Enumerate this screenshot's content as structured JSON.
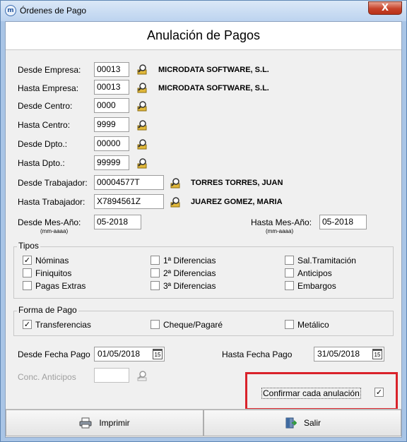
{
  "window": {
    "title": "Órdenes de Pago",
    "close": "X"
  },
  "header": {
    "title": "Anulación de Pagos"
  },
  "fields": {
    "desde_empresa": {
      "label": "Desde Empresa:",
      "value": "00013",
      "name": "MICRODATA SOFTWARE, S.L."
    },
    "hasta_empresa": {
      "label": "Hasta Empresa:",
      "value": "00013",
      "name": "MICRODATA SOFTWARE, S.L."
    },
    "desde_centro": {
      "label": "Desde Centro:",
      "value": "0000"
    },
    "hasta_centro": {
      "label": "Hasta Centro:",
      "value": "9999"
    },
    "desde_dpto": {
      "label": "Desde Dpto.:",
      "value": "00000"
    },
    "hasta_dpto": {
      "label": "Hasta Dpto.:",
      "value": "99999"
    },
    "desde_trabajador": {
      "label": "Desde Trabajador:",
      "value": "00004577T",
      "name": "TORRES TORRES, JUAN"
    },
    "hasta_trabajador": {
      "label": "Hasta Trabajador:",
      "value": "X7894561Z",
      "name": "JUAREZ GOMEZ, MARIA"
    },
    "desde_mes": {
      "label": "Desde Mes-Año:",
      "hint": "(mm-aaaa)",
      "value": "05-2018"
    },
    "hasta_mes": {
      "label": "Hasta Mes-Año:",
      "hint": "(mm-aaaa)",
      "value": "05-2018"
    }
  },
  "tipos": {
    "legend": "Tipos",
    "items": [
      {
        "label": "Nóminas",
        "checked": true
      },
      {
        "label": "Finiquitos",
        "checked": false
      },
      {
        "label": "Pagas Extras",
        "checked": false
      },
      {
        "label": "1ª Diferencias",
        "checked": false
      },
      {
        "label": "2ª Diferencias",
        "checked": false
      },
      {
        "label": "3ª Diferencias",
        "checked": false
      },
      {
        "label": "Sal.Tramitación",
        "checked": false
      },
      {
        "label": "Anticipos",
        "checked": false
      },
      {
        "label": "Embargos",
        "checked": false
      }
    ]
  },
  "forma_pago": {
    "legend": "Forma de Pago",
    "items": [
      {
        "label": "Transferencias",
        "checked": true
      },
      {
        "label": "Cheque/Pagaré",
        "checked": false
      },
      {
        "label": "Metálico",
        "checked": false
      }
    ]
  },
  "fechas": {
    "desde_label": "Desde Fecha Pago",
    "desde_value": "01/05/2018",
    "hasta_label": "Hasta Fecha Pago",
    "hasta_value": "31/05/2018",
    "calendar_glyph": "15"
  },
  "conc_anticipos": {
    "label": "Conc. Anticipos",
    "value": ""
  },
  "confirmar": {
    "label": "Confirmar cada anulación",
    "checked": true
  },
  "buttons": {
    "imprimir": "Imprimir",
    "salir": "Salir"
  },
  "check_mark": "✓",
  "colors": {
    "highlight": "#d9222a",
    "lookup_icon": "#e1b83a"
  }
}
